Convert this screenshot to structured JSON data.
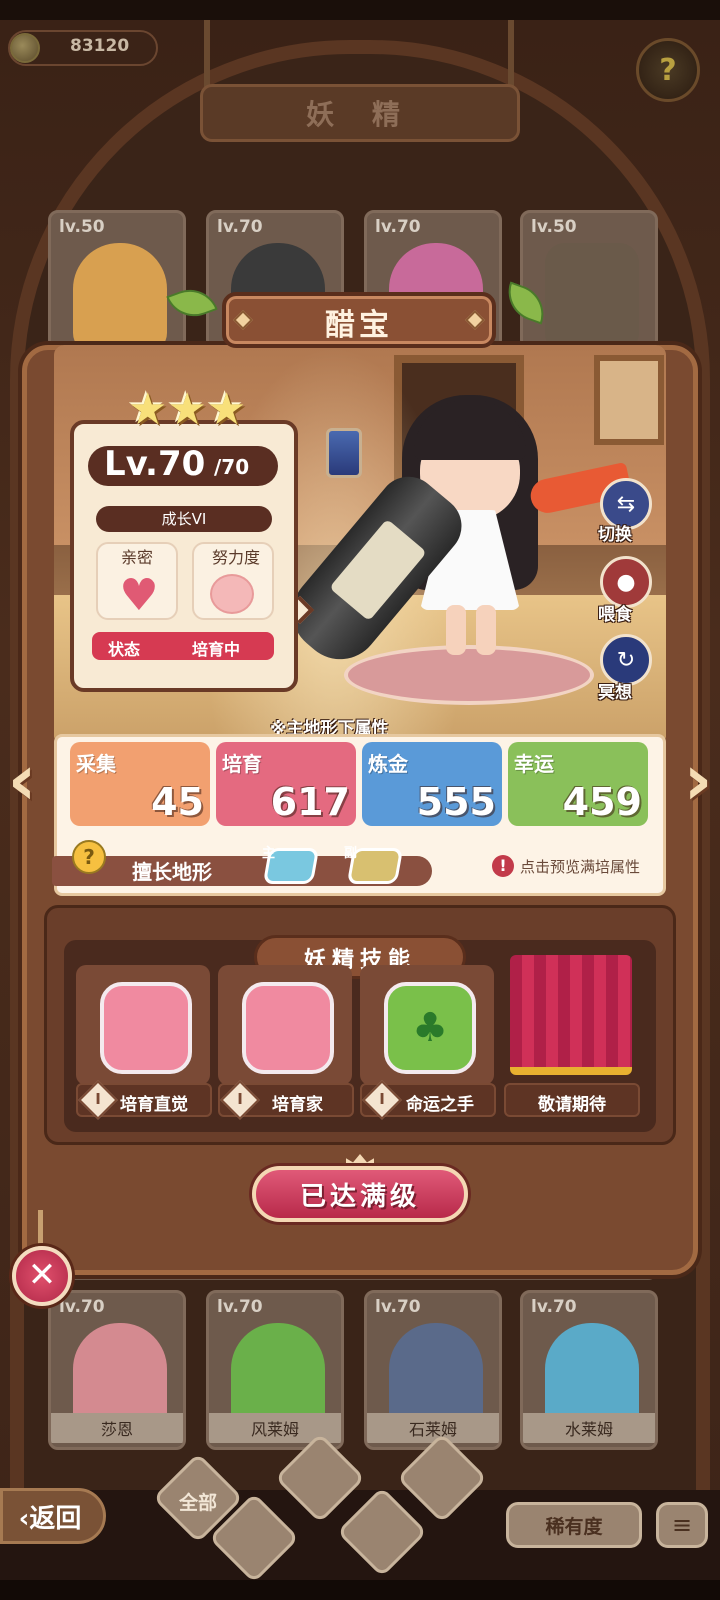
{
  "hud": {
    "coins": "83120",
    "screen_title": "妖 精",
    "help_icon": "?"
  },
  "background_cards_top": [
    {
      "level": "lv.50",
      "color": "#d8a050"
    },
    {
      "level": "lv.70",
      "color": "#3a3a3a"
    },
    {
      "level": "lv.70",
      "color": "#c86a9a"
    },
    {
      "level": "lv.50",
      "color": "#6a5a4a"
    }
  ],
  "background_cards_bottom": [
    {
      "level": "lv.70",
      "name": "莎恩",
      "color": "#d48a90"
    },
    {
      "level": "lv.70",
      "name": "风莱姆",
      "color": "#6ab04a"
    },
    {
      "level": "lv.70",
      "name": "石莱姆",
      "color": "#5a6a8a"
    },
    {
      "level": "lv.70",
      "name": "水莱姆",
      "color": "#5aaac8"
    }
  ],
  "fairy": {
    "name": "醋宝",
    "stars": 3,
    "level": "Lv.70",
    "level_max": "/70",
    "growth": "成长VI",
    "intimacy_label": "亲密",
    "effort_label": "努力度",
    "status_label": "状态",
    "status_value": "培育中"
  },
  "side_actions": [
    {
      "label": "切换",
      "icon": "switch-icon"
    },
    {
      "label": "喂食",
      "icon": "meat-icon"
    },
    {
      "label": "冥想",
      "icon": "meditate-icon"
    }
  ],
  "attributes": {
    "caption": "※主地形下属性",
    "items": [
      {
        "name": "采集",
        "value": "45",
        "color": "#f2a070"
      },
      {
        "name": "培育",
        "value": "617",
        "color": "#e46a80"
      },
      {
        "name": "炼金",
        "value": "555",
        "color": "#5a9ad8"
      },
      {
        "name": "幸运",
        "value": "459",
        "color": "#8ac05a"
      }
    ],
    "terrain_label": "擅长地形",
    "terrain_main_tag": "主",
    "terrain_sub_tag": "副",
    "hint": "点击预览满培属性",
    "hint_icon": "!"
  },
  "skills": {
    "title": "妖精技能",
    "items": [
      {
        "name": "培育直觉",
        "rank": "I",
        "color": "#f08aa0"
      },
      {
        "name": "培育家",
        "rank": "I",
        "color": "#f08aa0"
      },
      {
        "name": "命运之手",
        "rank": "I",
        "color": "#7ac04a"
      }
    ],
    "coming_soon": "敬请期待"
  },
  "max_level_button": "已达满级",
  "close_icon": "✕",
  "bottom": {
    "back": "‹返回",
    "all": "全部",
    "rarity": "稀有度",
    "sort_icon": "≡"
  }
}
